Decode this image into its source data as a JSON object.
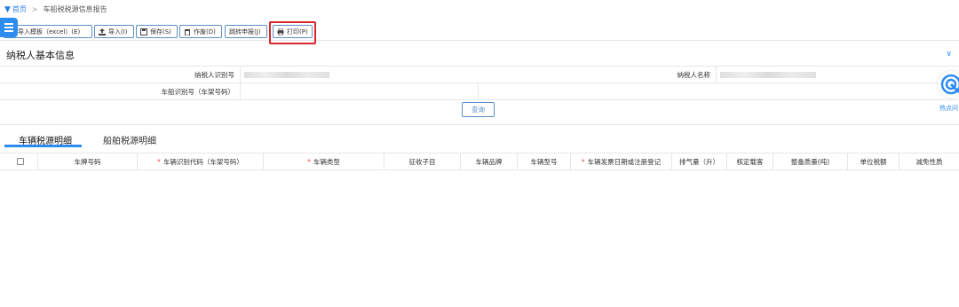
{
  "breadcrumb": {
    "home": "首页",
    "separator": ">",
    "current": "车船税税源信息报告"
  },
  "toolbar": {
    "import_template": "导入模板（excel）(E)",
    "import": "导入(I)",
    "save": "保存(S)",
    "void": "作废(D)",
    "jump_declare": "跳转申报(J)",
    "print": "打印(P)"
  },
  "taxpayer_section": {
    "title": "纳税人基本信息",
    "taxpayer_id_label": "纳税人识别号",
    "taxpayer_name_label": "纳税人名称",
    "vessel_id_label": "车船识别号（车架号码）",
    "query_button": "查询"
  },
  "tabs": [
    {
      "label": "车辆税源明细",
      "active": true
    },
    {
      "label": "船舶税源明细",
      "active": false
    }
  ],
  "grid": {
    "columns": [
      {
        "label": "车牌号码",
        "required": false
      },
      {
        "label": "车辆识别代码（车架号码）",
        "required": true
      },
      {
        "label": "车辆类型",
        "required": true
      },
      {
        "label": "征收子目",
        "required": false
      },
      {
        "label": "车辆品牌",
        "required": false
      },
      {
        "label": "车辆型号",
        "required": false
      },
      {
        "label": "车辆发票日期或注册登记",
        "required": true
      },
      {
        "label": "排气量（升）",
        "required": false
      },
      {
        "label": "核定载客",
        "required": false
      },
      {
        "label": "整备质量(吨)",
        "required": false
      },
      {
        "label": "单位税额",
        "required": false
      },
      {
        "label": "减免性质",
        "required": false
      }
    ]
  },
  "side_float": {
    "label": "热点问"
  },
  "colors": {
    "accent": "#2d8cf0",
    "highlight": "#d9262b",
    "required": "#e44444"
  }
}
